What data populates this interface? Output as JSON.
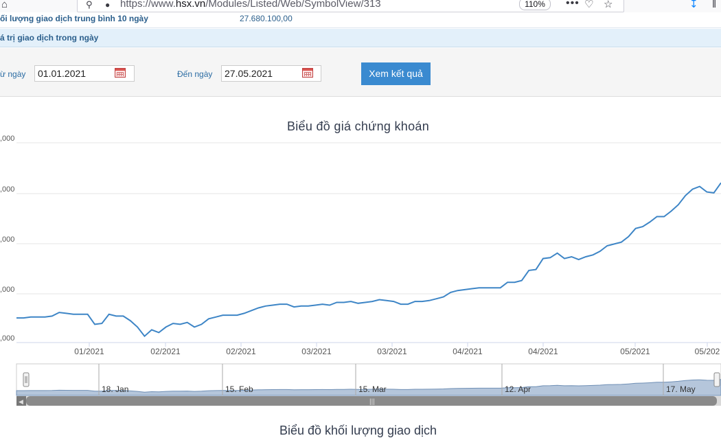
{
  "browser": {
    "url_prefix": "https://www.",
    "url_domain": "hsx.vn",
    "url_path": "/Modules/Listed/Web/SymbolView/313",
    "zoom": "110%",
    "icons": [
      "home-icon",
      "shield-icon",
      "lock-icon",
      "more-icon",
      "pocket-icon",
      "star-icon",
      "download-icon",
      "library-icon"
    ]
  },
  "info": {
    "row1_label": "ối lượng giao dịch trung bình 10 ngày",
    "row1_value": "27.680.100,00",
    "row2_label": "á trị giao dịch trong ngày"
  },
  "filter": {
    "from_label": "ừ ngày",
    "from_value": "01.01.2021",
    "to_label": "Đến ngày",
    "to_value": "27.05.2021",
    "submit": "Xem kết quả"
  },
  "chart_data": {
    "type": "line",
    "title": "Biểu đồ giá chứng khoán",
    "y_tick_labels": [
      ",000",
      ",000",
      ",000",
      ",000",
      ",000"
    ],
    "x_tick_labels": [
      "01/2021",
      "02/2021",
      "02/2021",
      "03/2021",
      "03/2021",
      "04/2021",
      "04/2021",
      "05/2021",
      "05/202"
    ],
    "navigator_labels": [
      "18. Jan",
      "15. Feb",
      "15. Mar",
      "12. Apr",
      "17. May"
    ],
    "grid": true,
    "series": [
      {
        "color": "#3d85c6",
        "values": [
          0.27,
          0.27,
          0.28,
          0.28,
          0.28,
          0.29,
          0.33,
          0.32,
          0.31,
          0.31,
          0.31,
          0.2,
          0.21,
          0.31,
          0.29,
          0.29,
          0.24,
          0.17,
          0.07,
          0.14,
          0.11,
          0.17,
          0.21,
          0.2,
          0.22,
          0.17,
          0.2,
          0.26,
          0.28,
          0.3,
          0.3,
          0.3,
          0.32,
          0.35,
          0.38,
          0.4,
          0.41,
          0.42,
          0.42,
          0.39,
          0.4,
          0.4,
          0.41,
          0.42,
          0.41,
          0.44,
          0.44,
          0.45,
          0.43,
          0.44,
          0.45,
          0.47,
          0.46,
          0.45,
          0.42,
          0.42,
          0.45,
          0.45,
          0.46,
          0.48,
          0.5,
          0.55,
          0.57,
          0.58,
          0.59,
          0.6,
          0.6,
          0.6,
          0.6,
          0.66,
          0.66,
          0.68,
          0.79,
          0.8,
          0.92,
          0.93,
          0.98,
          0.92,
          0.94,
          0.91,
          0.94,
          0.96,
          1.0,
          1.06,
          1.08,
          1.1,
          1.16,
          1.25,
          1.27,
          1.32,
          1.38,
          1.38,
          1.44,
          1.51,
          1.61,
          1.68,
          1.71,
          1.65,
          1.64,
          1.75
        ]
      }
    ]
  },
  "volume_chart": {
    "title": "Biểu đồ khối lượng giao dịch"
  }
}
